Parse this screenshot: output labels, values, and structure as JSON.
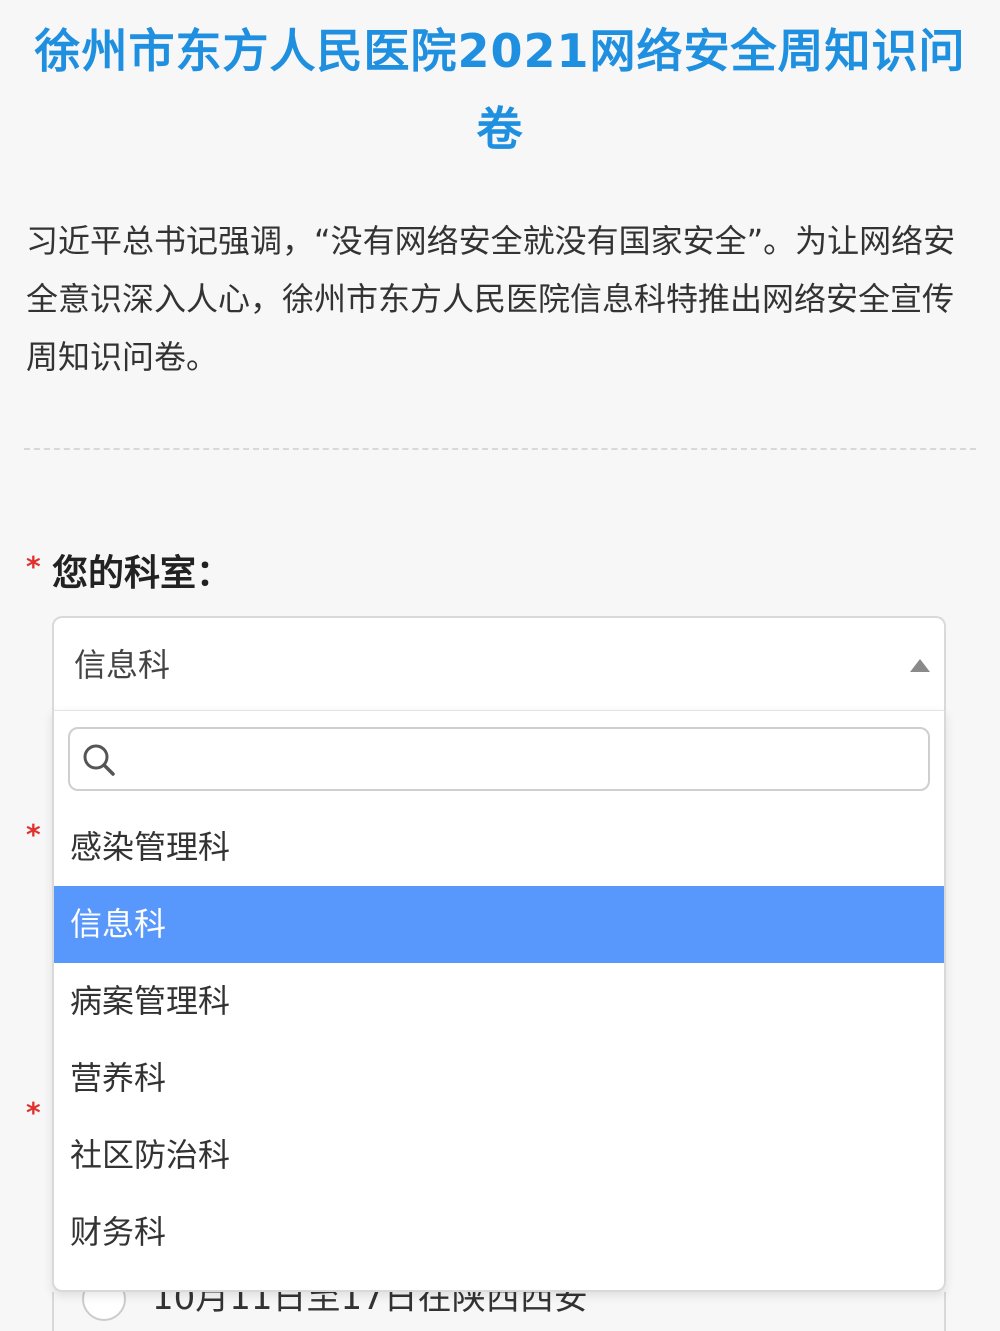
{
  "survey": {
    "title": "徐州市东方人民医院2021网络安全周知识问卷",
    "intro": "习近平总书记强调，“没有网络安全就没有国家安全”。为让网络安全意识深入人心，徐州市东方人民医院信息科特推出网络安全宣传周知识问卷。"
  },
  "question": {
    "required_mark": "*",
    "label": "您的科室：",
    "selected_value": "信息科",
    "search_placeholder": ""
  },
  "dropdown": {
    "options": [
      "感染管理科",
      "信息科",
      "病案管理科",
      "营养科",
      "社区防治科",
      "财务科"
    ],
    "selected_index": 1
  },
  "hidden_required_marks": [
    "*",
    "*"
  ],
  "behind_option_text": "10月11日至17日在陕西西安",
  "colors": {
    "title": "#1f8fe0",
    "required": "#e0312d",
    "highlight": "#5897fb"
  },
  "icons": [
    "search-icon",
    "caret-up-icon",
    "radio-icon"
  ]
}
